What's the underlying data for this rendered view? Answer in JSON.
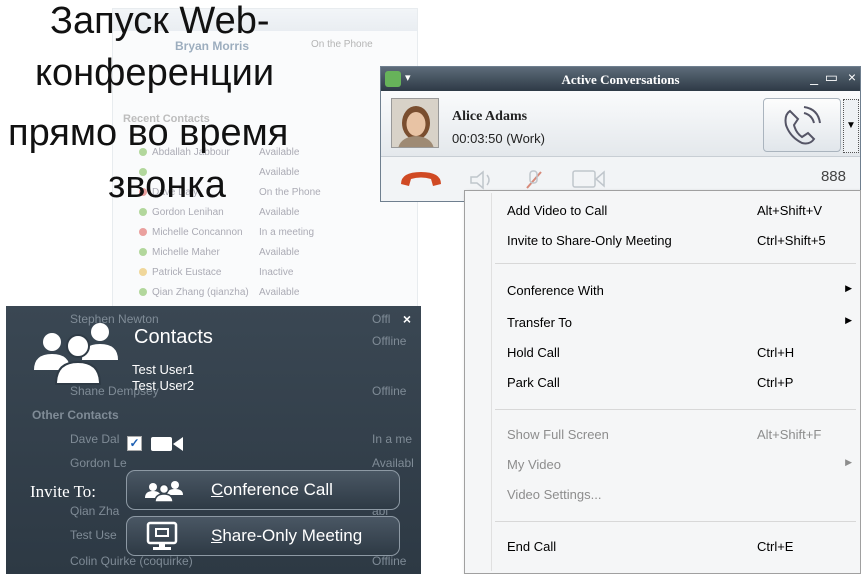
{
  "slide_title": {
    "line1": "Запуск Web-",
    "line2": "конференции",
    "line3": "прямо во время",
    "line4": "звонка"
  },
  "background_window": {
    "user_name": "Bryan Morris",
    "user_status": "On the Phone",
    "section": "Recent Contacts",
    "contacts": [
      {
        "name": "Abdallah Jabbour",
        "status": "Available",
        "color": "#74b84d"
      },
      {
        "name": "",
        "status": "Available",
        "color": "#74b84d"
      },
      {
        "name": "Dave Daly",
        "status": "On the Phone",
        "color": "#d9534f"
      },
      {
        "name": "Gordon Lenihan",
        "status": "Available",
        "color": "#74b84d"
      },
      {
        "name": "Michelle Concannon",
        "status": "In a meeting",
        "color": "#d9534f"
      },
      {
        "name": "Michelle Maher",
        "status": "Available",
        "color": "#74b84d"
      },
      {
        "name": "Patrick Eustace",
        "status": "Inactive",
        "color": "#e5b84a"
      },
      {
        "name": "Qian Zhang (qianzha)",
        "status": "Available",
        "color": "#74b84d"
      }
    ]
  },
  "contacts_panel": {
    "title": "Contacts",
    "users": [
      "Test User1",
      "Test User2"
    ],
    "invite_label": "Invite To:",
    "conference_call": "Conference Call",
    "share_only": "Share-Only Meeting",
    "close": "×",
    "ghost_rows": [
      {
        "name": "Stephen Newton",
        "status": "Offl"
      },
      {
        "name": "",
        "status": "Offline"
      },
      {
        "name": "Shane Dempsey",
        "status": "Offline"
      },
      {
        "name": "Other Contacts",
        "status": ""
      },
      {
        "name": "Dave Dal",
        "status": "In a me"
      },
      {
        "name": "Gordon Le",
        "status": "Availabl"
      },
      {
        "name": "Qian Zha",
        "status": "abl"
      },
      {
        "name": "Test Use",
        "status": ""
      },
      {
        "name": "Colin Quirke (coquirke)",
        "status": "Offline"
      }
    ]
  },
  "conversation_window": {
    "title": "Active Conversations",
    "contact_name": "Alice Adams",
    "call_time": "00:03:50  (Work)",
    "dialpad_digits": "888",
    "min": "_",
    "max": "▭",
    "close": "×"
  },
  "context_menu": {
    "items": [
      {
        "label": "Add Video to Call",
        "shortcut": "Alt+Shift+V",
        "disabled": false,
        "submenu": false
      },
      {
        "label": "Invite to Share-Only Meeting",
        "shortcut": "Ctrl+Shift+5",
        "disabled": false,
        "submenu": false
      },
      {
        "label": "Conference With",
        "shortcut": "",
        "disabled": false,
        "submenu": true
      },
      {
        "label": "Transfer To",
        "shortcut": "",
        "disabled": false,
        "submenu": true
      },
      {
        "label": "Hold Call",
        "shortcut": "Ctrl+H",
        "disabled": false,
        "submenu": false
      },
      {
        "label": "Park Call",
        "shortcut": "Ctrl+P",
        "disabled": false,
        "submenu": false
      },
      {
        "label": "Show Full Screen",
        "shortcut": "Alt+Shift+F",
        "disabled": true,
        "submenu": false
      },
      {
        "label": "My Video",
        "shortcut": "",
        "disabled": true,
        "submenu": true
      },
      {
        "label": "Video Settings...",
        "shortcut": "",
        "disabled": true,
        "submenu": false
      },
      {
        "label": "End Call",
        "shortcut": "Ctrl+E",
        "disabled": false,
        "submenu": false
      }
    ],
    "submenu_arrow": "▶"
  }
}
